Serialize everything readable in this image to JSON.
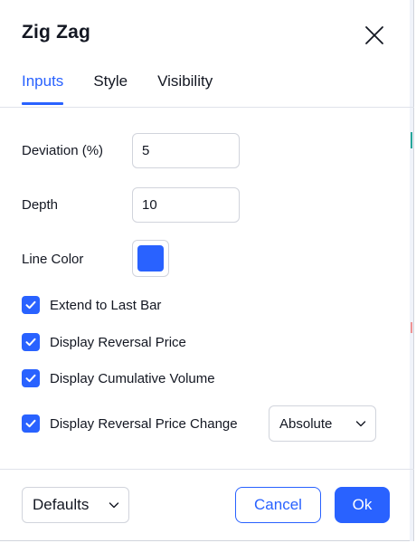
{
  "dialog": {
    "title": "Zig Zag",
    "close_icon": "close-icon"
  },
  "tabs": [
    {
      "label": "Inputs",
      "active": true
    },
    {
      "label": "Style",
      "active": false
    },
    {
      "label": "Visibility",
      "active": false
    }
  ],
  "inputs": {
    "deviation": {
      "label": "Deviation (%)",
      "value": "5"
    },
    "depth": {
      "label": "Depth",
      "value": "10"
    },
    "line_color": {
      "label": "Line Color",
      "color": "#2962ff"
    }
  },
  "options": [
    {
      "label": "Extend to Last Bar",
      "checked": true
    },
    {
      "label": "Display Reversal Price",
      "checked": true
    },
    {
      "label": "Display Cumulative Volume",
      "checked": true
    },
    {
      "label": "Display Reversal Price Change",
      "checked": true
    }
  ],
  "reversal_change_mode": {
    "selected": "Absolute",
    "icon": "chevron-down-icon"
  },
  "footer": {
    "defaults_label": "Defaults",
    "cancel_label": "Cancel",
    "ok_label": "Ok"
  },
  "colors": {
    "accent": "#2962ff",
    "text": "#131722",
    "border": "#d1d4dc",
    "divider": "#e0e3eb",
    "edge_green": "#26a69a",
    "edge_red": "#ef5350"
  }
}
